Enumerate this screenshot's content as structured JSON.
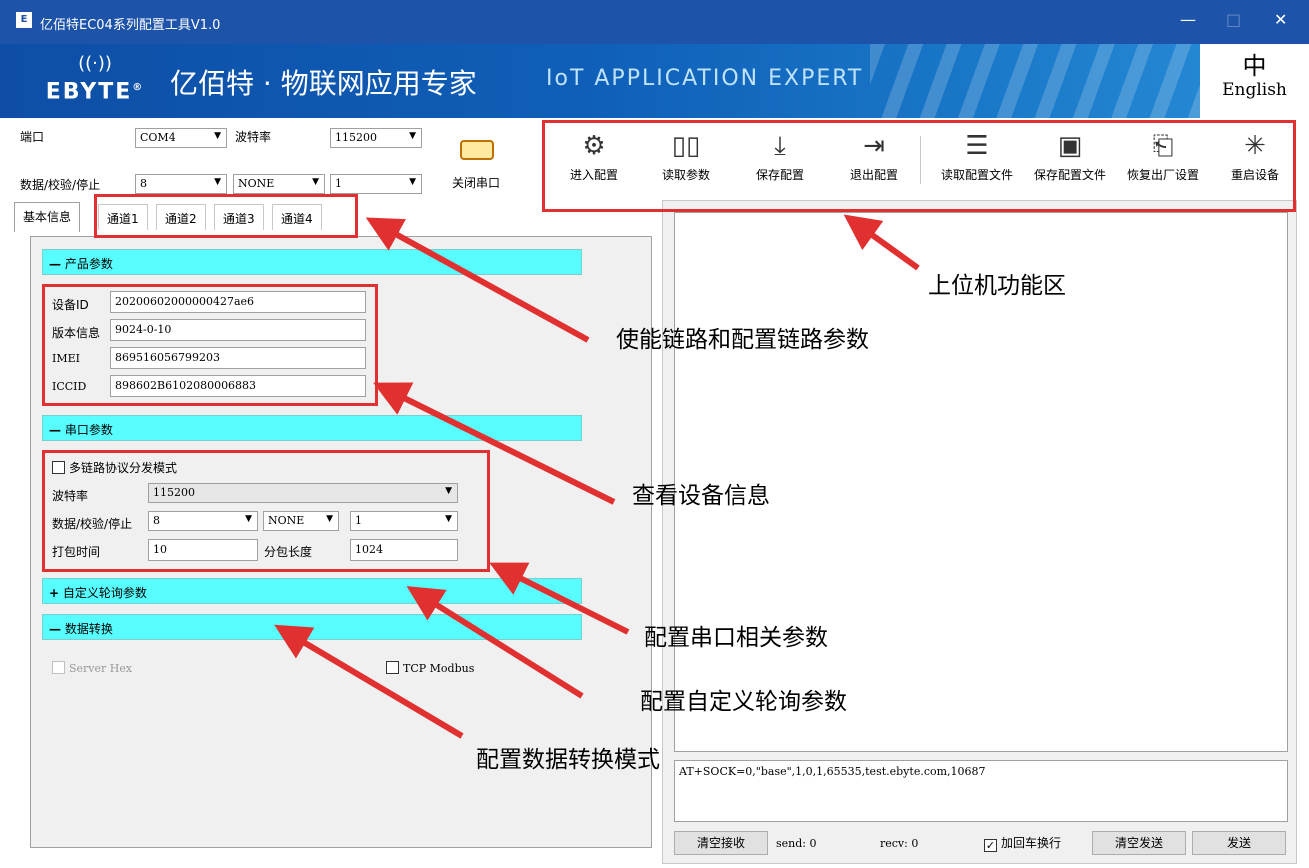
{
  "window": {
    "icon": "E",
    "title": "亿佰特EC04系列配置工具V1.0",
    "minimize": "—",
    "maximize": "□",
    "close": "✕"
  },
  "banner": {
    "signal": "((·))",
    "logo": "EBYTE",
    "registered": "®",
    "cn_title": "亿佰特 · 物联网应用专家",
    "en_title": "IoT APPLICATION EXPERT"
  },
  "lang": {
    "zh_icon": "中",
    "label": "English"
  },
  "port": {
    "port_label": "端口",
    "port_value": "COM4",
    "baud_label": "波特率",
    "baud_value": "115200",
    "dps_label": "数据/校验/停止",
    "data_bits": "8",
    "parity": "NONE",
    "stop_bits": "1",
    "close_port": "关闭串口"
  },
  "toolbar": [
    {
      "icon": "gear-icon",
      "label": "进入配置"
    },
    {
      "icon": "book-icon",
      "label": "读取参数"
    },
    {
      "icon": "download-icon",
      "label": "保存配置"
    },
    {
      "icon": "exit-icon",
      "label": "退出配置"
    },
    {
      "icon": "file-read-icon",
      "label": "读取配置文件"
    },
    {
      "icon": "file-save-icon",
      "label": "保存配置文件"
    },
    {
      "icon": "restore-icon",
      "label": "恢复出厂设置"
    },
    {
      "icon": "restart-icon",
      "label": "重启设备"
    }
  ],
  "tabs": [
    "基本信息",
    "通道1",
    "通道2",
    "通道3",
    "通道4"
  ],
  "product": {
    "header": "产品参数",
    "sign": "—",
    "rows": [
      {
        "label": "设备ID",
        "value": "20200602000000427ae6"
      },
      {
        "label": "版本信息",
        "value": "9024-0-10"
      },
      {
        "label": "IMEI",
        "value": "869516056799203"
      },
      {
        "label": "ICCID",
        "value": "898602B6102080006883"
      }
    ]
  },
  "serial": {
    "header": "串口参数",
    "sign": "—",
    "multi_link": "多链路协议分发模式",
    "baud_label": "波特率",
    "baud": "115200",
    "dps_label": "数据/校验/停止",
    "data_bits": "8",
    "parity": "NONE",
    "stop_bits": "1",
    "pack_time_label": "打包时间",
    "pack_time": "10",
    "pack_len_label": "分包长度",
    "pack_len": "1024"
  },
  "polling": {
    "header": "自定义轮询参数",
    "sign": "+"
  },
  "convert": {
    "header": "数据转换",
    "sign": "—",
    "server_hex": "Server Hex",
    "tcp_modbus": "TCP Modbus"
  },
  "console": {
    "send_text": "AT+SOCK=0,\"base\",1,0,1,65535,test.ebyte.com,10687",
    "clear_recv": "清空接收",
    "send_label": "send: 0",
    "recv_label": "recv: 0",
    "crlf": "加回车换行",
    "clear_send": "清空发送",
    "send_btn": "发送"
  },
  "annotations": [
    "上位机功能区",
    "使能链路和配置链路参数",
    "查看设备信息",
    "配置串口相关参数",
    "配置自定义轮询参数",
    "配置数据转换模式"
  ],
  "colors": {
    "title_bar": "#1e53aa",
    "section_bar": "#58fdfd",
    "annotation": "#e03030"
  }
}
